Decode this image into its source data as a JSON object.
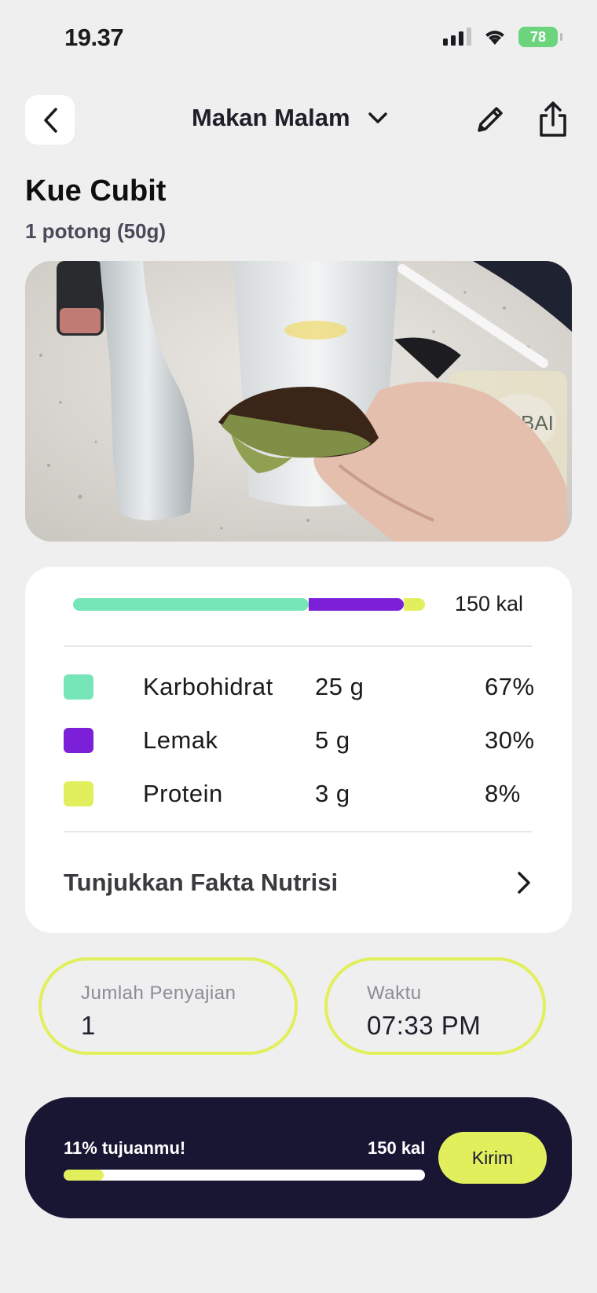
{
  "status_bar": {
    "time": "19.37",
    "battery": "78"
  },
  "header": {
    "meal": "Makan Malam"
  },
  "food": {
    "name": "Kue Cubit",
    "portion": "1 potong (50g)"
  },
  "nutrition": {
    "total_kcal": "150 kal",
    "macros": [
      {
        "name": "Karbohidrat",
        "grams": "25 g",
        "percent": "67%",
        "share": 0.67,
        "color": "#76e6b8"
      },
      {
        "name": "Lemak",
        "grams": "5 g",
        "percent": "30%",
        "share": 0.27,
        "color": "#7b1fd9"
      },
      {
        "name": "Protein",
        "grams": "3 g",
        "percent": "8%",
        "share": 0.06,
        "color": "#e2ef5c"
      }
    ],
    "facts_link": "Tunjukkan Fakta Nutrisi"
  },
  "serving": {
    "label": "Jumlah Penyajian",
    "value": "1"
  },
  "time": {
    "label": "Waktu",
    "value": "07:33 PM"
  },
  "goal": {
    "text": "11% tujuanmu!",
    "kcal": "150 kal",
    "progress": 0.11,
    "send_label": "Kirim"
  },
  "colors": {
    "accent": "#e2ef5c",
    "dark": "#181633",
    "carb": "#76e6b8",
    "fat": "#7b1fd9"
  }
}
